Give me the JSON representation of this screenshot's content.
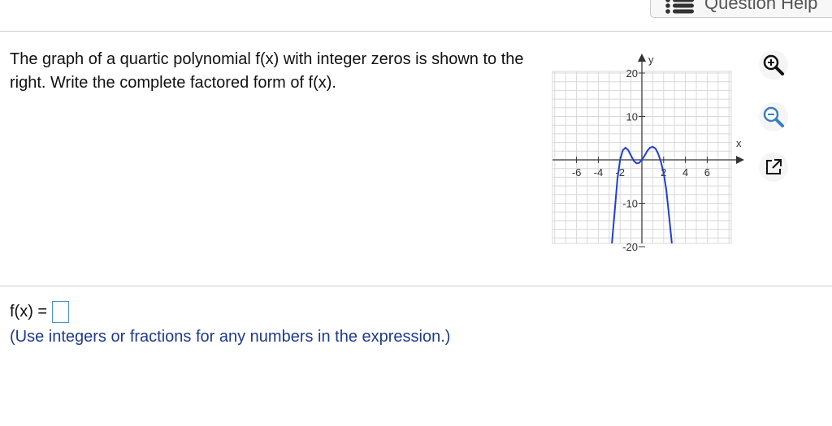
{
  "header": {
    "help_label": "Question Help",
    "help_icon": "list-icon"
  },
  "question": {
    "text": "The graph of a quartic polynomial f(x) with integer zeros is shown to the right. Write the complete factored form of f(x)."
  },
  "graph": {
    "x_axis_label": "x",
    "y_axis_label": "y",
    "x_ticks": [
      "-6",
      "-4",
      "-2",
      "2",
      "4",
      "6"
    ],
    "y_ticks": [
      "20",
      "10",
      "-10",
      "-20"
    ],
    "colors": {
      "curve": "#2040d0",
      "grid": "#d8d8d8",
      "axis": "#555555"
    }
  },
  "chart_data": {
    "type": "line",
    "title": "",
    "xlabel": "x",
    "ylabel": "y",
    "xlim": [
      -7,
      7
    ],
    "ylim": [
      -24,
      24
    ],
    "grid": true,
    "series": [
      {
        "points": [
          [
            -2.75,
            -22
          ],
          [
            -2.5,
            -12
          ],
          [
            -2.25,
            -4.4
          ],
          [
            -2,
            0
          ],
          [
            -1.75,
            2.2
          ],
          [
            -1.5,
            2.8
          ],
          [
            -1.25,
            2.2
          ],
          [
            -1,
            1
          ],
          [
            -0.75,
            -0.2
          ],
          [
            -0.5,
            -0.8
          ],
          [
            -0.25,
            -0.7
          ],
          [
            0,
            0
          ],
          [
            0.25,
            1
          ],
          [
            0.5,
            2.1
          ],
          [
            0.75,
            2.8
          ],
          [
            1,
            3
          ],
          [
            1.25,
            2.6
          ],
          [
            1.5,
            1.4
          ],
          [
            1.75,
            -0.5
          ],
          [
            2,
            -3
          ],
          [
            2.25,
            -7
          ],
          [
            2.5,
            -13
          ],
          [
            2.75,
            -22
          ]
        ]
      }
    ]
  },
  "tools": {
    "zoom_in_icon": "zoom-in-icon",
    "zoom_out_icon": "zoom-out-icon",
    "popout_icon": "popout-icon"
  },
  "answer": {
    "label": "f(x) =",
    "value": "",
    "hint": "(Use integers or fractions for any numbers in the expression.)"
  }
}
